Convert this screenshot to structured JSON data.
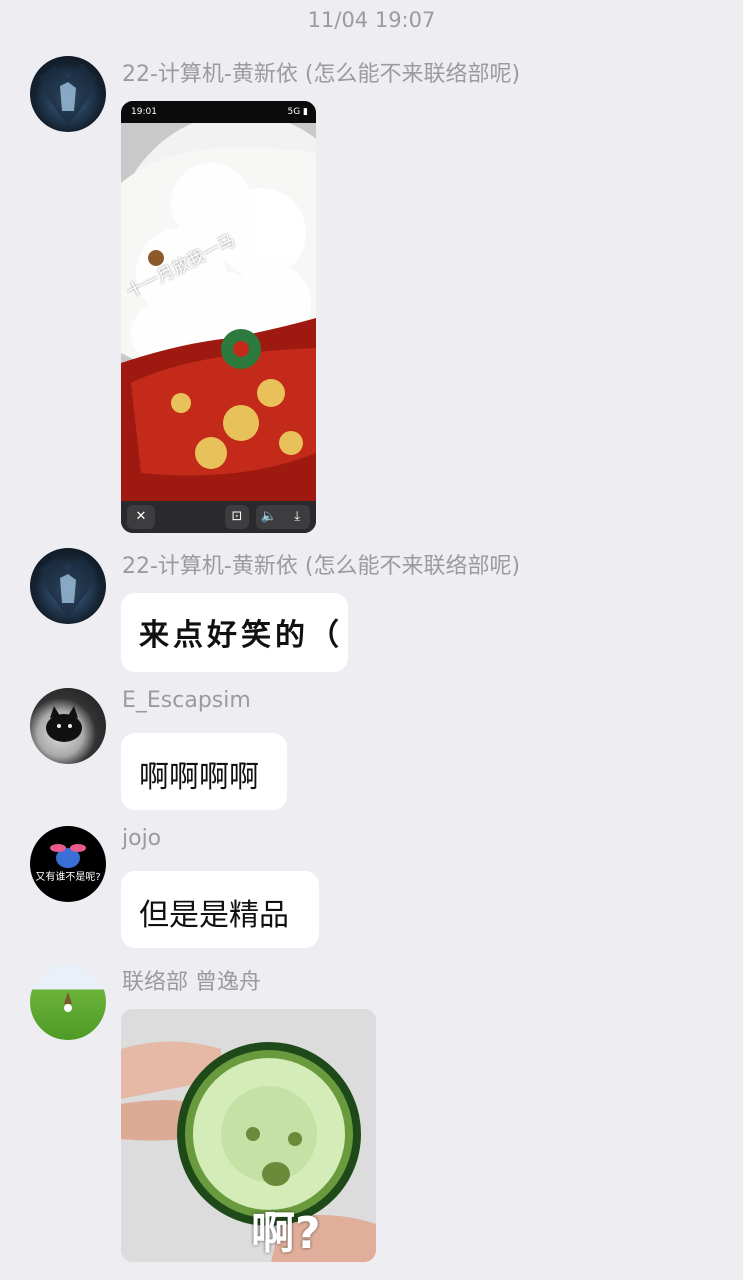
{
  "timestamp": "11/04 19:07",
  "messages": [
    {
      "sender": "22-计算机-黄新依 (怎么能不来联络部呢)",
      "type": "video",
      "video_overlay_text": "十一月放我一马",
      "video_status_time": "19:01",
      "video_status_right": "5G ▮"
    },
    {
      "sender": "22-计算机-黄新依 (怎么能不来联络部呢)",
      "type": "text",
      "text": "来点好笑的（"
    },
    {
      "sender": "E_Escapsim",
      "type": "text",
      "text": "啊啊啊啊"
    },
    {
      "sender": "jojo",
      "type": "text",
      "text": "但是是精品",
      "avatar_text": "又有谁不是呢?"
    },
    {
      "sender": "联络部 曾逸舟",
      "type": "sticker",
      "sticker_text": "啊?"
    }
  ],
  "video_controls": {
    "close": "✕",
    "screenshot": "⊡",
    "volume": "🔈",
    "download": "⤓"
  },
  "icons": [
    "close-icon",
    "screenshot-icon",
    "volume-icon",
    "download-icon"
  ]
}
